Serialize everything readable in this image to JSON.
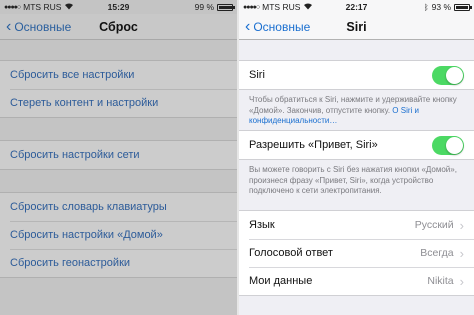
{
  "left": {
    "status": {
      "carrier": "MTS RUS",
      "time": "15:29",
      "battery": "99 %",
      "battery_level": 0.99
    },
    "nav": {
      "back_label": "Основные",
      "title": "Сброс"
    },
    "groups": [
      {
        "items": [
          {
            "label": "Сбросить все настройки"
          },
          {
            "label": "Стереть контент и настройки"
          }
        ]
      },
      {
        "items": [
          {
            "label": "Сбросить настройки сети"
          }
        ]
      },
      {
        "items": [
          {
            "label": "Сбросить словарь клавиатуры"
          },
          {
            "label": "Сбросить настройки «Домой»"
          },
          {
            "label": "Сбросить геонастройки"
          }
        ]
      }
    ]
  },
  "right": {
    "status": {
      "carrier": "MTS RUS",
      "time": "22:17",
      "battery": "93 %",
      "battery_level": 0.93
    },
    "nav": {
      "back_label": "Основные",
      "title": "Siri"
    },
    "siri_row": {
      "label": "Siri",
      "enabled": true
    },
    "siri_footer": {
      "text": "Чтобы обратиться к Siri, нажмите и удерживайте кнопку «Домой». Закончив, отпустите кнопку.",
      "link": "О Siri и конфиденциальности…"
    },
    "hey_siri_row": {
      "label": "Разрешить «Привет, Siri»",
      "enabled": true
    },
    "hey_siri_footer": {
      "text": "Вы можете говорить с Siri без нажатия кнопки «Домой», произнеся фразу «Привет, Siri», когда устройство подключено к сети электропитания."
    },
    "settings": [
      {
        "label": "Язык",
        "value": "Русский"
      },
      {
        "label": "Голосовой ответ",
        "value": "Всегда"
      },
      {
        "label": "Мои данные",
        "value": "Nikita"
      }
    ],
    "colors": {
      "accent": "#1a6fd0",
      "toggle_on": "#4cd964"
    }
  }
}
